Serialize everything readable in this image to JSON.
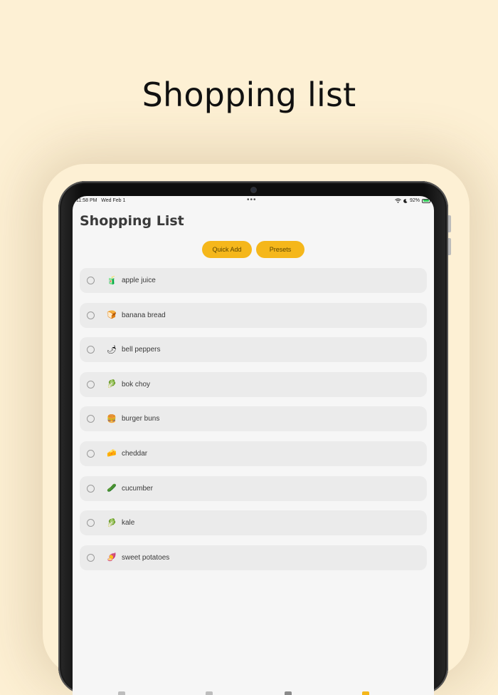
{
  "headline": "Shopping list",
  "status_bar": {
    "time": "11:58 PM",
    "date": "Wed Feb 1",
    "dots": "•••",
    "wifi_icon": "wifi-icon",
    "moon_icon": "moon-icon",
    "battery": "92%"
  },
  "app": {
    "title": "Shopping List",
    "quick_add_label": "Quick Add",
    "presets_label": "Presets",
    "accent_color": "#f5b71b"
  },
  "items": [
    {
      "emoji": "🧃",
      "label": "apple juice",
      "icon": "juice-box-icon"
    },
    {
      "emoji": "🍞",
      "label": "banana bread",
      "icon": "bread-icon"
    },
    {
      "emoji": "🌶",
      "label": "bell peppers",
      "icon": "pepper-icon"
    },
    {
      "emoji": "🥬",
      "label": "bok choy",
      "icon": "leafy-green-icon"
    },
    {
      "emoji": "🍔",
      "label": "burger buns",
      "icon": "burger-icon"
    },
    {
      "emoji": "🧀",
      "label": "cheddar",
      "icon": "cheese-icon"
    },
    {
      "emoji": "🥒",
      "label": "cucumber",
      "icon": "cucumber-icon"
    },
    {
      "emoji": "🥬",
      "label": "kale",
      "icon": "leafy-green-icon"
    },
    {
      "emoji": "🍠",
      "label": "sweet potatoes",
      "icon": "sweet-potato-icon"
    }
  ]
}
